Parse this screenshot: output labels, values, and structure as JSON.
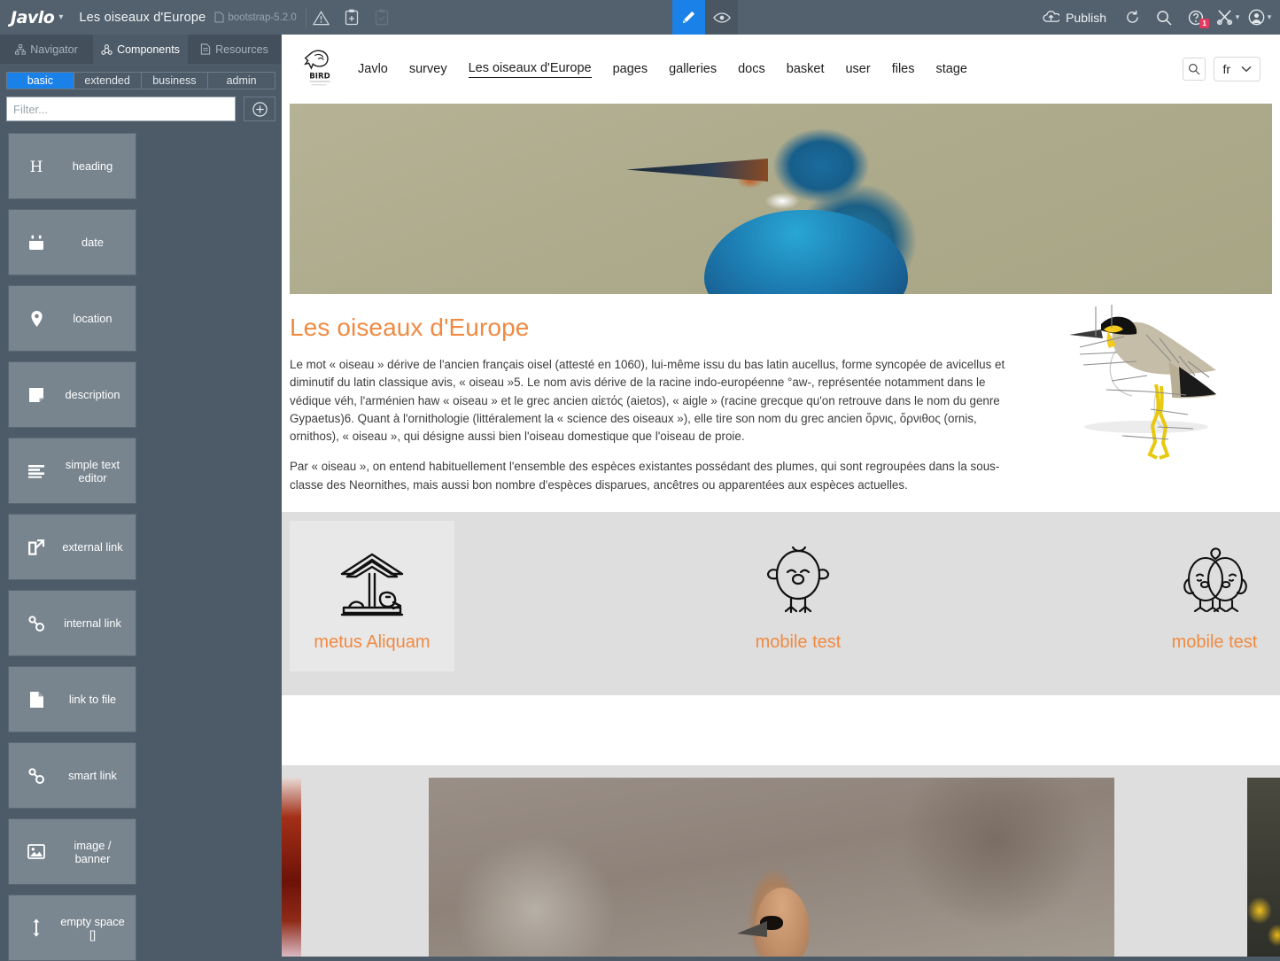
{
  "topbar": {
    "brand": "Javlo",
    "brand_caret": "▾",
    "doc_title": "Les oiseaux d'Europe",
    "template_chip": "bootstrap-5.2.0",
    "icons": [
      "warning-icon",
      "paste-add-icon",
      "clipboard-icon"
    ],
    "mode_edit": "edit-mode",
    "mode_preview": "preview-mode",
    "publish_label": "Publish",
    "help_badge": "1",
    "right_icons": [
      "refresh-icon",
      "search-icon",
      "help-icon",
      "tools-icon",
      "account-icon"
    ]
  },
  "sidebar": {
    "tabs": [
      {
        "label": "Navigator",
        "icon": "sitemap-icon",
        "active": false
      },
      {
        "label": "Components",
        "icon": "components-icon",
        "active": true
      },
      {
        "label": "Resources",
        "icon": "file-icon",
        "active": false
      }
    ],
    "segments": [
      {
        "label": "basic",
        "active": true
      },
      {
        "label": "extended",
        "active": false
      },
      {
        "label": "business",
        "active": false
      },
      {
        "label": "admin",
        "active": false
      }
    ],
    "filter_placeholder": "Filter...",
    "filter_value": "",
    "add_label": "add-component",
    "components": [
      {
        "label": "heading",
        "icon": "heading-icon"
      },
      {
        "label": "date",
        "icon": "calendar-icon"
      },
      {
        "label": "location",
        "icon": "pin-icon"
      },
      {
        "label": "description",
        "icon": "note-icon"
      },
      {
        "label": "simple text editor",
        "icon": "text-lines-icon"
      },
      {
        "label": "external link",
        "icon": "external-link-icon"
      },
      {
        "label": "internal link",
        "icon": "chain-icon"
      },
      {
        "label": "link to file",
        "icon": "document-icon"
      },
      {
        "label": "smart link",
        "icon": "chain-icon"
      },
      {
        "label": "image / banner",
        "icon": "image-icon"
      },
      {
        "label": "empty space []",
        "icon": "vertical-arrows-icon"
      }
    ]
  },
  "site": {
    "logo_alt": "bird-logo",
    "menu": [
      {
        "label": "Javlo",
        "current": false
      },
      {
        "label": "survey",
        "current": false
      },
      {
        "label": "Les oiseaux d'Europe",
        "current": true
      },
      {
        "label": "pages",
        "current": false
      },
      {
        "label": "galleries",
        "current": false
      },
      {
        "label": "docs",
        "current": false
      },
      {
        "label": "basket",
        "current": false
      },
      {
        "label": "user",
        "current": false
      },
      {
        "label": "files",
        "current": false
      },
      {
        "label": "stage",
        "current": false
      }
    ],
    "search_icon": "search-icon",
    "language": "fr",
    "language_caret": "⌄",
    "hero_alt": "kingfisher-photo",
    "article": {
      "title": "Les oiseaux d'Europe",
      "paragraph1": "Le mot « oiseau » dérive de l'ancien français oisel (attesté en 1060), lui-même issu du bas latin aucellus, forme syncopée de avicellus et diminutif du latin classique avis, « oiseau »5. Le nom avis dérive de la racine indo-européenne °aw-, représentée notamment dans le védique véh, l'arménien haw « oiseau » et le grec ancien αἰετός (aietos), « aigle » (racine grecque qu'on retrouve dans le nom du genre Gypaetus)6. Quant à l'ornithologie (littéralement la « science des oiseaux »), elle tire son nom du grec ancien ὄρνις, ὄρνιθος (ornis, ornithos), « oiseau », qui désigne aussi bien l'oiseau domestique que l'oiseau de proie.",
      "paragraph2": "Par « oiseau », on entend habituellement l'ensemble des espèces existantes possédant des plumes, qui sont regroupées dans la sous-classe des Neornithes, mais aussi bon nombre d'espèces disparues, ancêtres ou apparentées aux espèces actuelles.",
      "illustration_alt": "lapwing-illustration"
    },
    "cards": [
      {
        "label": "metus Aliquam",
        "icon": "bird-feeder-icon",
        "highlighted": true
      },
      {
        "label": "mobile test",
        "icon": "chick-icon",
        "highlighted": false
      },
      {
        "label": "mobile test",
        "icon": "love-birds-icon",
        "highlighted": false
      }
    ],
    "photos": [
      {
        "alt": "red-bird-photo"
      },
      {
        "alt": "eurasian-jay-photo"
      },
      {
        "alt": "yellow-flowers-photo"
      }
    ]
  },
  "colors": {
    "accent_orange": "#f08a42",
    "accent_blue": "#1a81e8",
    "chrome": "#53616e",
    "panel": "#4d5b68",
    "badge_red": "#e23a5e"
  }
}
